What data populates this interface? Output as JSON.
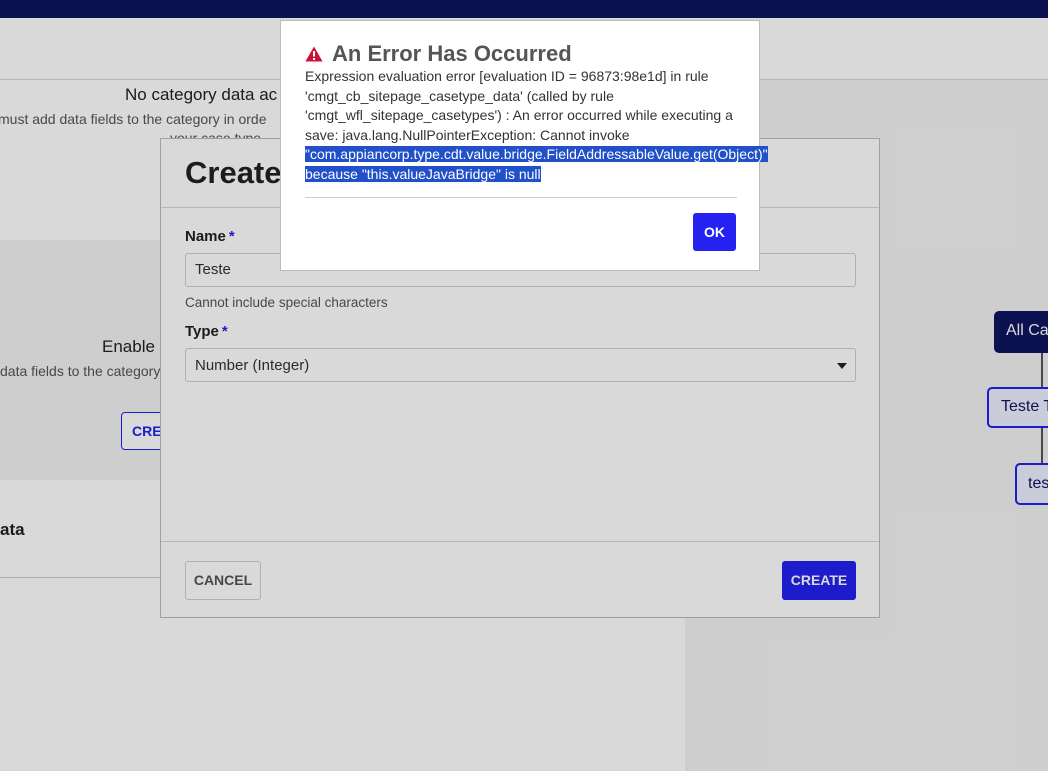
{
  "background": {
    "empty_title": "No category data ac",
    "empty_subtitle": "must add data fields to the category in orde",
    "empty_subtitle2": "your case type",
    "enable_title": "Enable",
    "enable_subtitle": "data fields to the category",
    "create_button": "CREA",
    "data_section_title": "ata",
    "tree": {
      "root": "All Ca",
      "child1": "Teste T",
      "child2": "tes"
    }
  },
  "create_dialog": {
    "title": "Create",
    "name_label": "Name",
    "required_marker": "*",
    "name_value": "Teste",
    "name_help": "Cannot include special characters",
    "type_label": "Type",
    "type_value": "Number (Integer)",
    "cancel_label": "CANCEL",
    "create_label": "CREATE"
  },
  "error_dialog": {
    "icon": "warning-triangle-icon",
    "title": "An Error Has Occurred",
    "message_plain": "Expression evaluation error [evaluation ID = 96873:98e1d] in rule 'cmgt_cb_sitepage_casetype_data' (called by rule 'cmgt_wfl_sitepage_casetypes') : An error occurred while executing a save: java.lang.NullPointerException: Cannot invoke ",
    "message_selected": "\"com.appiancorp.type.cdt.value.bridge.FieldAddressableValue.get(Object)\" because \"this.valueJavaBridge\" is null",
    "ok_label": "OK"
  },
  "colors": {
    "accent": "#2322f0",
    "topbar": "#0f1460",
    "warning": "#d0103a"
  }
}
